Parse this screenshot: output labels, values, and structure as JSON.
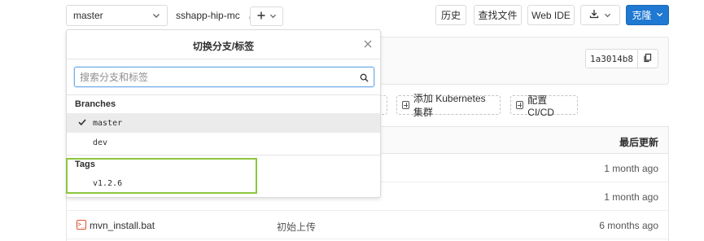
{
  "toolbar": {
    "branch_selected": "master",
    "project_path": "sshapp-hip-mc",
    "path_separator": "/",
    "history_label": "历史",
    "find_file_label": "查找文件",
    "web_ide_label": "Web IDE",
    "clone_label": "克隆",
    "accent_color": "#1f78d1"
  },
  "commit": {
    "sha": "1a3014b8"
  },
  "actions": {
    "add_kubernetes": "添加 Kubernetes 集群",
    "setup_cicd": "配置 CI/CD"
  },
  "table": {
    "header_last_update": "最后更新",
    "rows": [
      {
        "name": "",
        "message": "",
        "updated": "1 month ago"
      },
      {
        "name": "",
        "message": "",
        "updated": "1 month ago"
      },
      {
        "name": "mvn_install.bat",
        "message": "初始上传",
        "updated": "6 months ago"
      }
    ]
  },
  "dropdown": {
    "title": "切换分支/标签",
    "search_placeholder": "搜索分支和标签",
    "branches_header": "Branches",
    "branches": [
      "master",
      "dev"
    ],
    "tags_header": "Tags",
    "tags": [
      "v1.2.6"
    ],
    "highlight_color": "#8cc63f"
  }
}
